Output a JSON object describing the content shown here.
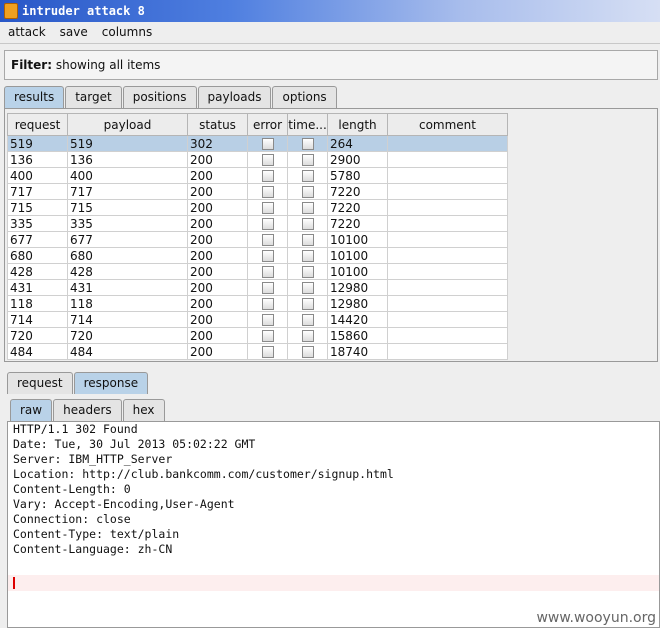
{
  "window": {
    "title": "intruder attack 8"
  },
  "menu": {
    "items": [
      "attack",
      "save",
      "columns"
    ]
  },
  "filter": {
    "label": "Filter:",
    "value": "showing all items"
  },
  "top_tabs": [
    "results",
    "target",
    "positions",
    "payloads",
    "options"
  ],
  "table": {
    "columns": [
      "request",
      "payload",
      "status",
      "error",
      "time...",
      "length",
      "comment"
    ],
    "rows": [
      {
        "request": "519",
        "payload": "519",
        "status": "302",
        "length": "264",
        "selected": true
      },
      {
        "request": "136",
        "payload": "136",
        "status": "200",
        "length": "2900"
      },
      {
        "request": "400",
        "payload": "400",
        "status": "200",
        "length": "5780"
      },
      {
        "request": "717",
        "payload": "717",
        "status": "200",
        "length": "7220"
      },
      {
        "request": "715",
        "payload": "715",
        "status": "200",
        "length": "7220"
      },
      {
        "request": "335",
        "payload": "335",
        "status": "200",
        "length": "7220"
      },
      {
        "request": "677",
        "payload": "677",
        "status": "200",
        "length": "10100"
      },
      {
        "request": "680",
        "payload": "680",
        "status": "200",
        "length": "10100"
      },
      {
        "request": "428",
        "payload": "428",
        "status": "200",
        "length": "10100"
      },
      {
        "request": "431",
        "payload": "431",
        "status": "200",
        "length": "12980"
      },
      {
        "request": "118",
        "payload": "118",
        "status": "200",
        "length": "12980"
      },
      {
        "request": "714",
        "payload": "714",
        "status": "200",
        "length": "14420"
      },
      {
        "request": "720",
        "payload": "720",
        "status": "200",
        "length": "15860"
      },
      {
        "request": "484",
        "payload": "484",
        "status": "200",
        "length": "18740"
      }
    ]
  },
  "detail_tabs": [
    "request",
    "response"
  ],
  "view_tabs": [
    "raw",
    "headers",
    "hex"
  ],
  "response_lines": [
    "HTTP/1.1 302 Found",
    "Date: Tue, 30 Jul 2013 05:02:22 GMT",
    "Server: IBM_HTTP_Server",
    "Location: http://club.bankcomm.com/customer/signup.html",
    "Content-Length: 0",
    "Vary: Accept-Encoding,User-Agent",
    "Connection: close",
    "Content-Type: text/plain",
    "Content-Language: zh-CN"
  ],
  "watermark": "www.wooyun.org"
}
